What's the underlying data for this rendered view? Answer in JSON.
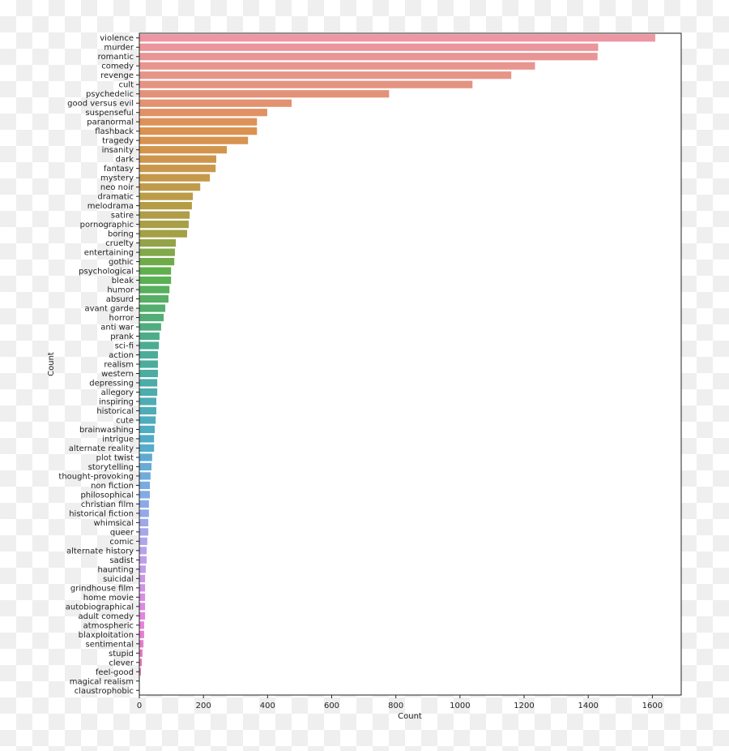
{
  "chart_data": {
    "type": "bar",
    "orientation": "horizontal",
    "title": "",
    "xlabel": "Count",
    "ylabel": "Count",
    "xlim": [
      0,
      1690
    ],
    "xticks": [
      0,
      200,
      400,
      600,
      800,
      1000,
      1200,
      1400,
      1600
    ],
    "grid": false,
    "legend": "none",
    "categories": [
      "violence",
      "murder",
      "romantic",
      "comedy",
      "revenge",
      "cult",
      "psychedelic",
      "good versus evil",
      "suspenseful",
      "paranormal",
      "flashback",
      "tragedy",
      "insanity",
      "dark",
      "fantasy",
      "mystery",
      "neo noir",
      "dramatic",
      "melodrama",
      "satire",
      "pornographic",
      "boring",
      "cruelty",
      "entertaining",
      "gothic",
      "psychological",
      "bleak",
      "humor",
      "absurd",
      "avant garde",
      "horror",
      "anti war",
      "prank",
      "sci-fi",
      "action",
      "realism",
      "western",
      "depressing",
      "allegory",
      "inspiring",
      "historical",
      "cute",
      "brainwashing",
      "intrigue",
      "alternate reality",
      "plot twist",
      "storytelling",
      "thought-provoking",
      "non fiction",
      "philosophical",
      "christian film",
      "historical fiction",
      "whimsical",
      "queer",
      "comic",
      "alternate history",
      "sadist",
      "haunting",
      "suicidal",
      "grindhouse film",
      "home movie",
      "autobiographical",
      "adult comedy",
      "atmospheric",
      "blaxploitation",
      "sentimental",
      "stupid",
      "clever",
      "feel-good",
      "magical realism",
      "claustrophobic"
    ],
    "values": [
      1609,
      1431,
      1429,
      1234,
      1160,
      1039,
      779,
      475,
      399,
      367,
      367,
      339,
      273,
      240,
      238,
      220,
      190,
      167,
      164,
      157,
      154,
      149,
      114,
      111,
      109,
      99,
      99,
      94,
      91,
      81,
      76,
      68,
      63,
      61,
      58,
      58,
      58,
      56,
      56,
      53,
      53,
      51,
      48,
      46,
      46,
      40,
      38,
      35,
      33,
      33,
      30,
      30,
      28,
      28,
      25,
      23,
      23,
      20,
      18,
      18,
      18,
      18,
      18,
      15,
      15,
      13,
      10,
      8,
      5,
      1,
      1
    ],
    "palette": "husl"
  }
}
